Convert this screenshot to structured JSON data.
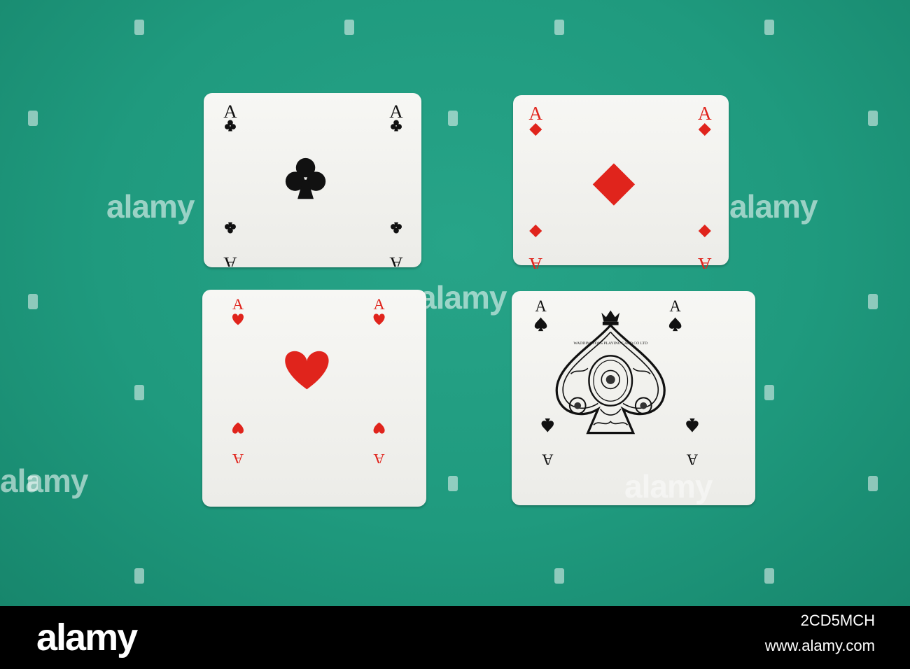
{
  "scene": {
    "background": "#1f9a7e",
    "watermark_text": "alamy"
  },
  "cards": [
    {
      "rank": "A",
      "suit": "clubs",
      "color": "#111111",
      "icon": "club-icon"
    },
    {
      "rank": "A",
      "suit": "diamonds",
      "color": "#e0241c",
      "icon": "diamond-icon"
    },
    {
      "rank": "A",
      "suit": "hearts",
      "color": "#e0241c",
      "icon": "heart-icon"
    },
    {
      "rank": "A",
      "suit": "spades",
      "color": "#111111",
      "icon": "spade-icon"
    }
  ],
  "spade_ace_inscription": "WADDINGTONS PLAYING CARD CO LTD",
  "footer": {
    "brand": "alamy",
    "image_code": "2CD5MCH",
    "url": "www.alamy.com"
  }
}
